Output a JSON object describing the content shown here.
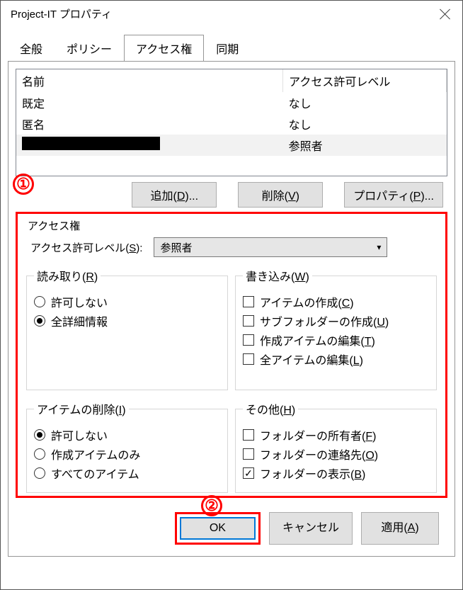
{
  "titlebar": {
    "title": "Project-IT プロパティ"
  },
  "tabs": [
    "全般",
    "ポリシー",
    "アクセス権",
    "同期"
  ],
  "active_tab": 2,
  "table": {
    "headers": [
      "名前",
      "アクセス許可レベル"
    ],
    "rows": [
      {
        "name": "既定",
        "level": "なし",
        "selected": false
      },
      {
        "name": "匿名",
        "level": "なし",
        "selected": false
      },
      {
        "name": "",
        "redacted": true,
        "level": "参照者",
        "selected": true
      }
    ]
  },
  "actions": {
    "add": "追加(D)...",
    "remove": "削除(V)",
    "props": "プロパティ(P)..."
  },
  "annotations": {
    "one": "①",
    "two": "②"
  },
  "perm": {
    "group_label": "アクセス権",
    "level_label": "アクセス許可レベル(S):",
    "level_value": "参照者",
    "read": {
      "legend": "読み取り(R)",
      "opts": [
        {
          "label": "許可しない",
          "checked": false
        },
        {
          "label": "全詳細情報",
          "checked": true
        }
      ]
    },
    "write": {
      "legend": "書き込み(W)",
      "opts": [
        {
          "label": "アイテムの作成(C)",
          "checked": false
        },
        {
          "label": "サブフォルダーの作成(U)",
          "checked": false
        },
        {
          "label": "作成アイテムの編集(T)",
          "checked": false
        },
        {
          "label": "全アイテムの編集(L)",
          "checked": false
        }
      ]
    },
    "delete": {
      "legend": "アイテムの削除(I)",
      "opts": [
        {
          "label": "許可しない",
          "checked": true
        },
        {
          "label": "作成アイテムのみ",
          "checked": false
        },
        {
          "label": "すべてのアイテム",
          "checked": false
        }
      ]
    },
    "other": {
      "legend": "その他(H)",
      "opts": [
        {
          "label": "フォルダーの所有者(F)",
          "checked": false
        },
        {
          "label": "フォルダーの連絡先(O)",
          "checked": false
        },
        {
          "label": "フォルダーの表示(B)",
          "checked": true
        }
      ]
    }
  },
  "footer": {
    "ok": "OK",
    "cancel": "キャンセル",
    "apply": "適用(A)"
  }
}
